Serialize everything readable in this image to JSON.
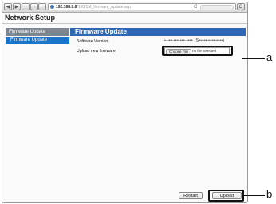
{
  "browser": {
    "nav_back": "◀",
    "nav_forward": "▶",
    "url_host": "192.168.0.6",
    "url_path": "/100/1M_firmware_update.asp",
    "reload_glyph": "C",
    "stop_glyph": "O"
  },
  "page": {
    "title": "Network Setup"
  },
  "sidebar": {
    "header": "Firmware Update",
    "items": [
      {
        "label": "Firmware Update"
      }
    ]
  },
  "main": {
    "header": "Firmware Update",
    "software_version_label": "Software Version:",
    "software_version_value": "•-•••-•••-•••-•••• (S•••••-••••-••••)",
    "upload_label": "Upload new firmware",
    "choose_file_label": "Choose File",
    "no_file_text": "no file selected",
    "restart_label": "Restart",
    "upload_button_label": "Upload"
  },
  "callouts": {
    "a": "a",
    "b": "b"
  },
  "colors": {
    "accent": "#2f67b4",
    "sidebar_selected": "#1b74c8",
    "sidebar_header": "#7d8590"
  }
}
